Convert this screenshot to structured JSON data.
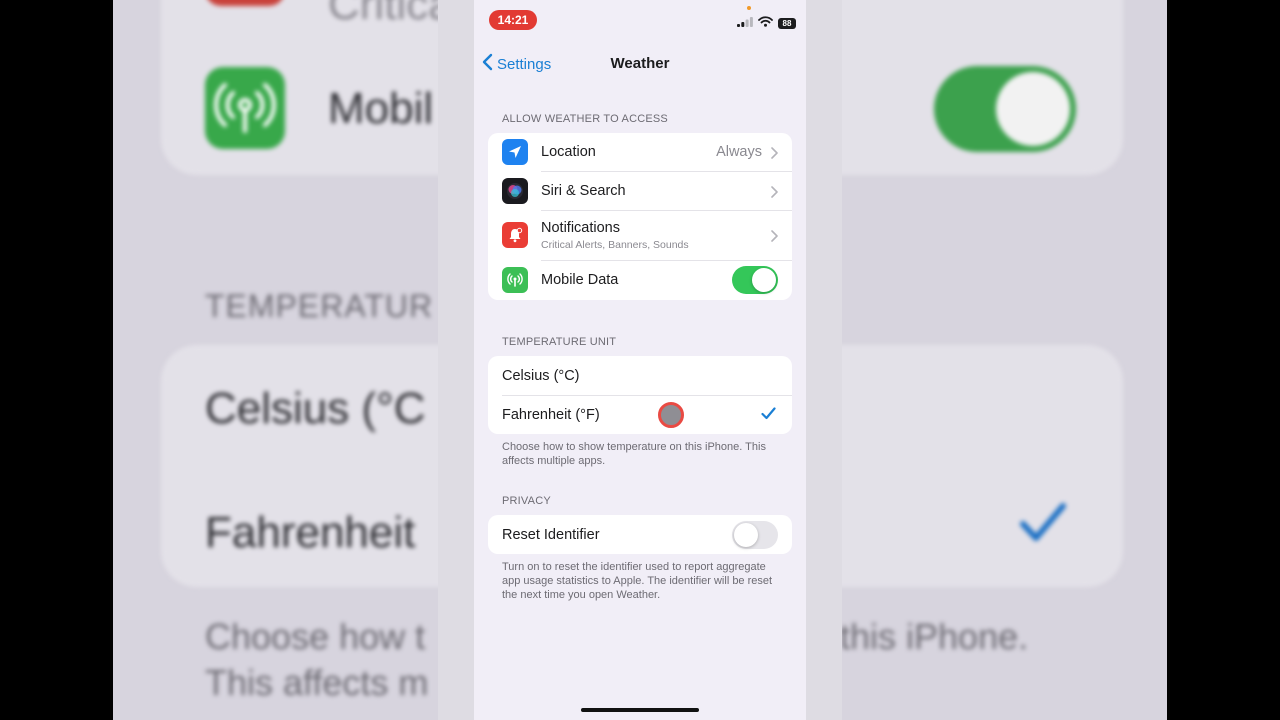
{
  "background_view": {
    "row_text_top": "Critical",
    "row_text_mobile": "Mobil",
    "section": "TEMPERATUR",
    "celsius": "Celsius (°C",
    "fahrenheit": "Fahrenheit",
    "footer_line1_left": "Choose how t",
    "footer_line1_right": "this iPhone.",
    "footer_line2_left": "This affects m"
  },
  "status_bar": {
    "time": "14:21",
    "battery": "88"
  },
  "nav": {
    "back_label": "Settings",
    "title": "Weather"
  },
  "access": {
    "header": "ALLOW WEATHER TO ACCESS",
    "items": [
      {
        "label": "Location",
        "value": "Always",
        "icon": "location-arrow-icon"
      },
      {
        "label": "Siri & Search",
        "icon": "siri-icon"
      },
      {
        "label": "Notifications",
        "sublabel": "Critical Alerts, Banners, Sounds",
        "icon": "notifications-bell-icon"
      },
      {
        "label": "Mobile Data",
        "toggle": true,
        "icon": "antenna-icon"
      }
    ]
  },
  "temperature_unit": {
    "header": "TEMPERATURE UNIT",
    "options": [
      {
        "label": "Celsius (°C)",
        "selected": false
      },
      {
        "label": "Fahrenheit (°F)",
        "selected": true
      }
    ],
    "footer": "Choose how to show temperature on this iPhone. This affects multiple apps."
  },
  "privacy": {
    "header": "PRIVACY",
    "reset_label": "Reset Identifier",
    "reset_toggle": false,
    "footer": "Turn on to reset the identifier used to report aggregate app usage statistics to Apple. The identifier will be reset the next time you open Weather."
  },
  "colors": {
    "accent": "#1a7fd4",
    "toggle_on": "#34c759",
    "location_icon": "#1e82f0",
    "notifications_icon": "#ea3d35",
    "mobile_data_icon": "#3cbf56",
    "status_time_bg": "#e23a33"
  }
}
